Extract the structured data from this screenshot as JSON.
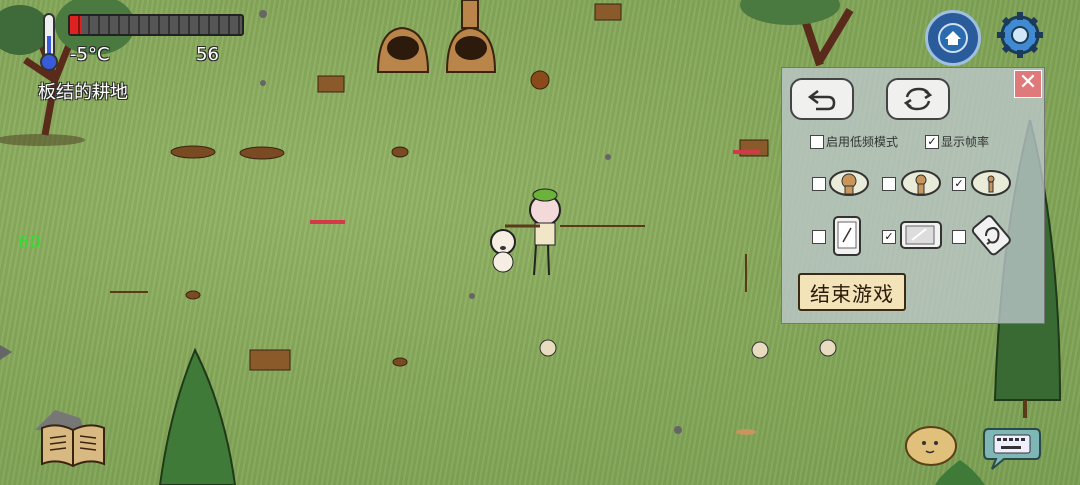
{
  "hud": {
    "temperature": "-5°C",
    "food": "56",
    "biome": "板结的耕地",
    "fps": "60",
    "health_fraction": 0.07
  },
  "settings_panel": {
    "close_label": "✕",
    "low_freq_label": "启用低频模式",
    "show_fps_label": "显示帧率",
    "low_freq_checked": false,
    "show_fps_checked": true,
    "view_row": [
      false,
      false,
      true
    ],
    "device_row": [
      false,
      true,
      false
    ],
    "end_game_label": "结束游戏"
  },
  "colors": {
    "grass": "#86a95a",
    "panel": "#bec8cd",
    "close": "#e07a7a",
    "fps": "#33dd33",
    "health": "#dd2222"
  },
  "icons": [
    "thermometer-icon",
    "home-icon",
    "gear-icon",
    "undo-icon",
    "sync-icon",
    "book-icon",
    "potato-icon",
    "keyboard-icon"
  ]
}
